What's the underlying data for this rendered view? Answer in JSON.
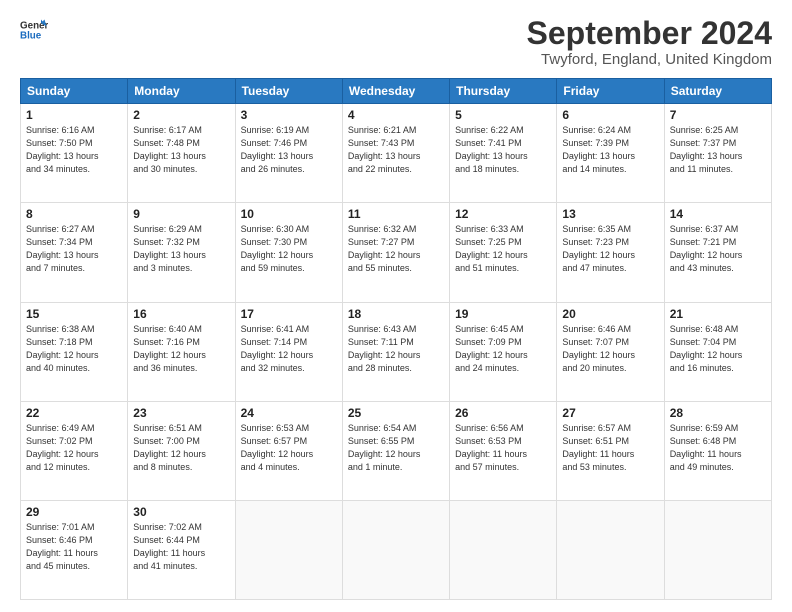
{
  "header": {
    "logo_line1": "General",
    "logo_line2": "Blue",
    "month_title": "September 2024",
    "location": "Twyford, England, United Kingdom"
  },
  "calendar": {
    "days_of_week": [
      "Sunday",
      "Monday",
      "Tuesday",
      "Wednesday",
      "Thursday",
      "Friday",
      "Saturday"
    ],
    "weeks": [
      [
        null,
        {
          "day": 2,
          "info": "Sunrise: 6:17 AM\nSunset: 7:48 PM\nDaylight: 13 hours\nand 30 minutes."
        },
        {
          "day": 3,
          "info": "Sunrise: 6:19 AM\nSunset: 7:46 PM\nDaylight: 13 hours\nand 26 minutes."
        },
        {
          "day": 4,
          "info": "Sunrise: 6:21 AM\nSunset: 7:43 PM\nDaylight: 13 hours\nand 22 minutes."
        },
        {
          "day": 5,
          "info": "Sunrise: 6:22 AM\nSunset: 7:41 PM\nDaylight: 13 hours\nand 18 minutes."
        },
        {
          "day": 6,
          "info": "Sunrise: 6:24 AM\nSunset: 7:39 PM\nDaylight: 13 hours\nand 14 minutes."
        },
        {
          "day": 7,
          "info": "Sunrise: 6:25 AM\nSunset: 7:37 PM\nDaylight: 13 hours\nand 11 minutes."
        }
      ],
      [
        {
          "day": 8,
          "info": "Sunrise: 6:27 AM\nSunset: 7:34 PM\nDaylight: 13 hours\nand 7 minutes."
        },
        {
          "day": 9,
          "info": "Sunrise: 6:29 AM\nSunset: 7:32 PM\nDaylight: 13 hours\nand 3 minutes."
        },
        {
          "day": 10,
          "info": "Sunrise: 6:30 AM\nSunset: 7:30 PM\nDaylight: 12 hours\nand 59 minutes."
        },
        {
          "day": 11,
          "info": "Sunrise: 6:32 AM\nSunset: 7:27 PM\nDaylight: 12 hours\nand 55 minutes."
        },
        {
          "day": 12,
          "info": "Sunrise: 6:33 AM\nSunset: 7:25 PM\nDaylight: 12 hours\nand 51 minutes."
        },
        {
          "day": 13,
          "info": "Sunrise: 6:35 AM\nSunset: 7:23 PM\nDaylight: 12 hours\nand 47 minutes."
        },
        {
          "day": 14,
          "info": "Sunrise: 6:37 AM\nSunset: 7:21 PM\nDaylight: 12 hours\nand 43 minutes."
        }
      ],
      [
        {
          "day": 15,
          "info": "Sunrise: 6:38 AM\nSunset: 7:18 PM\nDaylight: 12 hours\nand 40 minutes."
        },
        {
          "day": 16,
          "info": "Sunrise: 6:40 AM\nSunset: 7:16 PM\nDaylight: 12 hours\nand 36 minutes."
        },
        {
          "day": 17,
          "info": "Sunrise: 6:41 AM\nSunset: 7:14 PM\nDaylight: 12 hours\nand 32 minutes."
        },
        {
          "day": 18,
          "info": "Sunrise: 6:43 AM\nSunset: 7:11 PM\nDaylight: 12 hours\nand 28 minutes."
        },
        {
          "day": 19,
          "info": "Sunrise: 6:45 AM\nSunset: 7:09 PM\nDaylight: 12 hours\nand 24 minutes."
        },
        {
          "day": 20,
          "info": "Sunrise: 6:46 AM\nSunset: 7:07 PM\nDaylight: 12 hours\nand 20 minutes."
        },
        {
          "day": 21,
          "info": "Sunrise: 6:48 AM\nSunset: 7:04 PM\nDaylight: 12 hours\nand 16 minutes."
        }
      ],
      [
        {
          "day": 22,
          "info": "Sunrise: 6:49 AM\nSunset: 7:02 PM\nDaylight: 12 hours\nand 12 minutes."
        },
        {
          "day": 23,
          "info": "Sunrise: 6:51 AM\nSunset: 7:00 PM\nDaylight: 12 hours\nand 8 minutes."
        },
        {
          "day": 24,
          "info": "Sunrise: 6:53 AM\nSunset: 6:57 PM\nDaylight: 12 hours\nand 4 minutes."
        },
        {
          "day": 25,
          "info": "Sunrise: 6:54 AM\nSunset: 6:55 PM\nDaylight: 12 hours\nand 1 minute."
        },
        {
          "day": 26,
          "info": "Sunrise: 6:56 AM\nSunset: 6:53 PM\nDaylight: 11 hours\nand 57 minutes."
        },
        {
          "day": 27,
          "info": "Sunrise: 6:57 AM\nSunset: 6:51 PM\nDaylight: 11 hours\nand 53 minutes."
        },
        {
          "day": 28,
          "info": "Sunrise: 6:59 AM\nSunset: 6:48 PM\nDaylight: 11 hours\nand 49 minutes."
        }
      ],
      [
        {
          "day": 29,
          "info": "Sunrise: 7:01 AM\nSunset: 6:46 PM\nDaylight: 11 hours\nand 45 minutes."
        },
        {
          "day": 30,
          "info": "Sunrise: 7:02 AM\nSunset: 6:44 PM\nDaylight: 11 hours\nand 41 minutes."
        },
        null,
        null,
        null,
        null,
        null
      ]
    ],
    "day1": {
      "day": 1,
      "info": "Sunrise: 6:16 AM\nSunset: 7:50 PM\nDaylight: 13 hours\nand 34 minutes."
    }
  }
}
